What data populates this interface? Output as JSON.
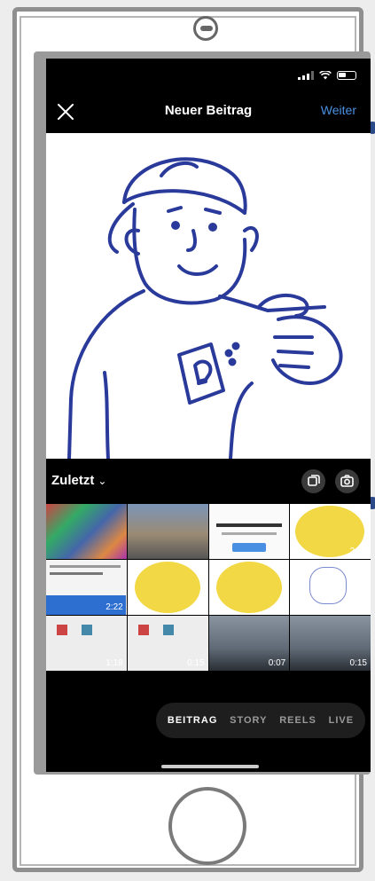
{
  "nav": {
    "title": "Neuer Beitrag",
    "next_label": "Weiter"
  },
  "gallery": {
    "label": "Zuletzt",
    "chevron": "⌄"
  },
  "tiles": [
    {
      "duration": ""
    },
    {
      "duration": ""
    },
    {
      "duration": ""
    },
    {
      "duration": "2:26"
    },
    {
      "duration": "2:22"
    },
    {
      "duration": ""
    },
    {
      "duration": ""
    },
    {
      "duration": ""
    },
    {
      "duration": "1:18"
    },
    {
      "duration": "0:15"
    },
    {
      "duration": "0:07"
    },
    {
      "duration": "0:15"
    }
  ],
  "modes": [
    {
      "label": "BEITRAG"
    },
    {
      "label": "STORY"
    },
    {
      "label": "REELS"
    },
    {
      "label": "LIVE"
    }
  ],
  "colors": {
    "accent": "#4a90e2",
    "drawing": "#2a3a9a",
    "circle_yellow": "#f2d844"
  }
}
